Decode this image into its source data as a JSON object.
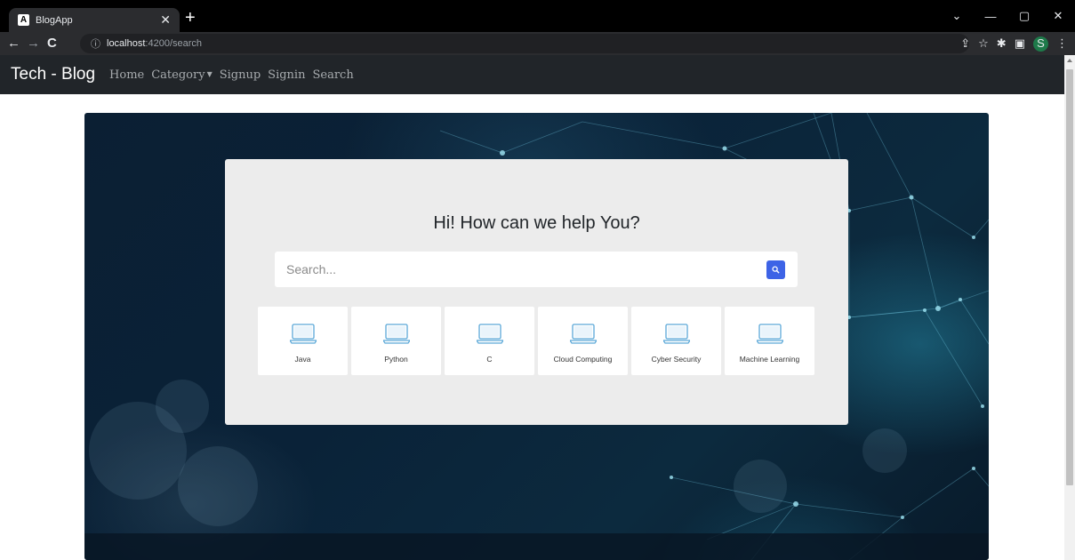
{
  "browser": {
    "tab_title": "BlogApp",
    "tab_favicon": "A",
    "url_host": "localhost",
    "url_path": ":4200/search",
    "profile_initial": "S"
  },
  "navbar": {
    "brand": "Tech - Blog",
    "links": [
      "Home",
      "Category",
      "Signup",
      "Signin",
      "Search"
    ]
  },
  "hero": {
    "heading": "Hi! How can we help You?",
    "search_placeholder": "Search...",
    "search_icon": "search-icon",
    "categories": [
      {
        "label": "Java",
        "icon": "laptop-icon"
      },
      {
        "label": "Python",
        "icon": "laptop-icon"
      },
      {
        "label": "C",
        "icon": "laptop-icon"
      },
      {
        "label": "Cloud Computing",
        "icon": "laptop-icon"
      },
      {
        "label": "Cyber Security",
        "icon": "laptop-icon"
      },
      {
        "label": "Machine Learning",
        "icon": "laptop-icon"
      }
    ]
  },
  "colors": {
    "navbar_bg": "#212529",
    "accent_button": "#3d63e6",
    "card_bg": "#ececec",
    "laptop_icon": "#5aa8d8"
  }
}
